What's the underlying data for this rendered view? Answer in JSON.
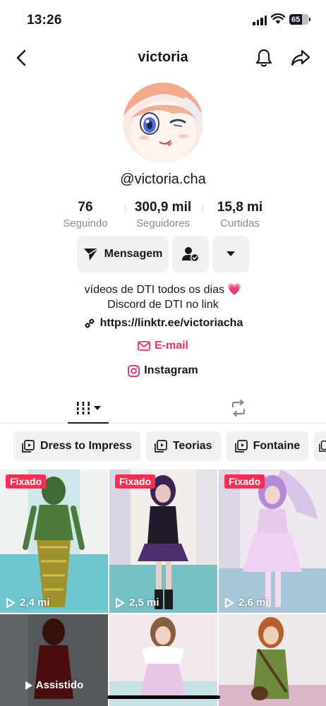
{
  "status_bar": {
    "time": "13:26",
    "battery": "65"
  },
  "header": {
    "title": "victoria"
  },
  "profile": {
    "username": "@victoria.cha",
    "stats": [
      {
        "value": "76",
        "label": "Seguindo"
      },
      {
        "value": "300,9 mil",
        "label": "Seguidores"
      },
      {
        "value": "15,8 mi",
        "label": "Curtidas"
      }
    ],
    "message_button": "Mensagem",
    "bio_line1": "vídeos de DTI todos os dias 💗",
    "bio_line2": "Discord de DTI no link",
    "link": "https://linktr.ee/victoriacha",
    "email": "E-mail",
    "instagram": "Instagram"
  },
  "playlists": [
    "Dress to Impress",
    "Teorias",
    "Fontaine"
  ],
  "videos": [
    {
      "badge": "Fixado",
      "views": "2,4 mi"
    },
    {
      "badge": "Fixado",
      "views": "2,5 mi"
    },
    {
      "badge": "Fixado",
      "views": "2,6 mi"
    },
    {
      "status": "Assistido"
    },
    {},
    {}
  ],
  "colors": {
    "accent": "#fe2c55",
    "text": "#161823",
    "secondary": "#8a8b91",
    "button_bg": "#f1f1f2"
  }
}
